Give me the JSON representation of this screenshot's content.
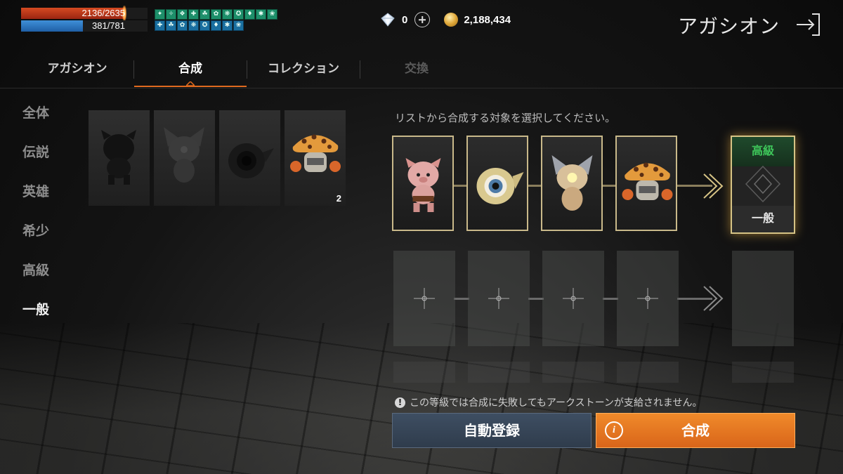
{
  "hud": {
    "hp": {
      "text": "2136/2635",
      "current": 2136,
      "max": 2635
    },
    "mp": {
      "text": "381/781",
      "current": 381,
      "max": 781
    },
    "buff_count_row1": 11,
    "buff_count_row2": 8
  },
  "currency": {
    "diamonds": "0",
    "gold": "2,188,434"
  },
  "header": {
    "title": "アガシオン"
  },
  "tabs": [
    {
      "label": "アガシオン",
      "state": "normal"
    },
    {
      "label": "合成",
      "state": "active"
    },
    {
      "label": "コレクション",
      "state": "normal"
    },
    {
      "label": "交換",
      "state": "disabled"
    }
  ],
  "filters": [
    "全体",
    "伝説",
    "英雄",
    "希少",
    "高級",
    "一般"
  ],
  "active_filter": "一般",
  "inventory": [
    {
      "name": "pig",
      "count": ""
    },
    {
      "name": "cat",
      "count": ""
    },
    {
      "name": "eyeball",
      "count": ""
    },
    {
      "name": "mushroom",
      "count": "2"
    }
  ],
  "synthesis": {
    "hint": "リストから合成する対象を選択してください。",
    "row1": [
      "pig",
      "eyeball",
      "cat",
      "mushroom"
    ],
    "result": {
      "top": "高級",
      "bottom": "一般"
    },
    "warning": "この等級では合成に失敗してもアークストーンが支給されません。",
    "auto_button": "自動登録",
    "synth_button": "合成"
  },
  "colors": {
    "accent": "#e06a1f",
    "result_green": "#3ec65a",
    "slot_border": "#c9b98a"
  }
}
